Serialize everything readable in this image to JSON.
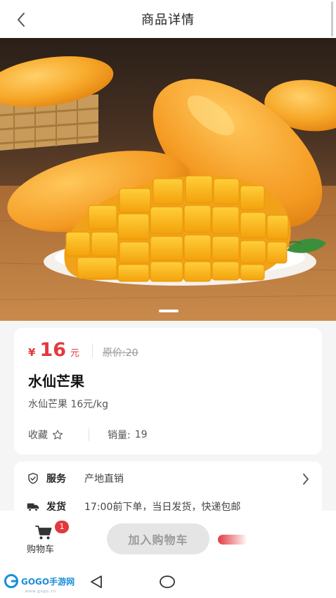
{
  "header": {
    "title": "商品详情",
    "back_icon": "chevron-left-icon"
  },
  "gallery": {
    "image_description": "mango-photo"
  },
  "product": {
    "currency_symbol": "¥",
    "price": "16",
    "price_unit": "元",
    "original_price": "原价:20",
    "name": "水仙芒果",
    "description": "水仙芒果 16元/kg",
    "favorite_label": "收藏",
    "sales_label": "销量:",
    "sales_count": "19"
  },
  "services": [
    {
      "icon": "shield-check-icon",
      "label": "服务",
      "value": "产地直销"
    },
    {
      "icon": "truck-icon",
      "label": "发货",
      "value": "17:00前下单，当日发货，快递包邮"
    }
  ],
  "bottom_bar": {
    "cart_label": "购物车",
    "cart_badge": "1",
    "add_to_cart_label": "加入购物车"
  },
  "watermark": {
    "text": "GOGO手游网",
    "sub": "www.gogo.cn"
  },
  "colors": {
    "accent": "#e2393f",
    "disabled_button": "#e5e5e5"
  }
}
